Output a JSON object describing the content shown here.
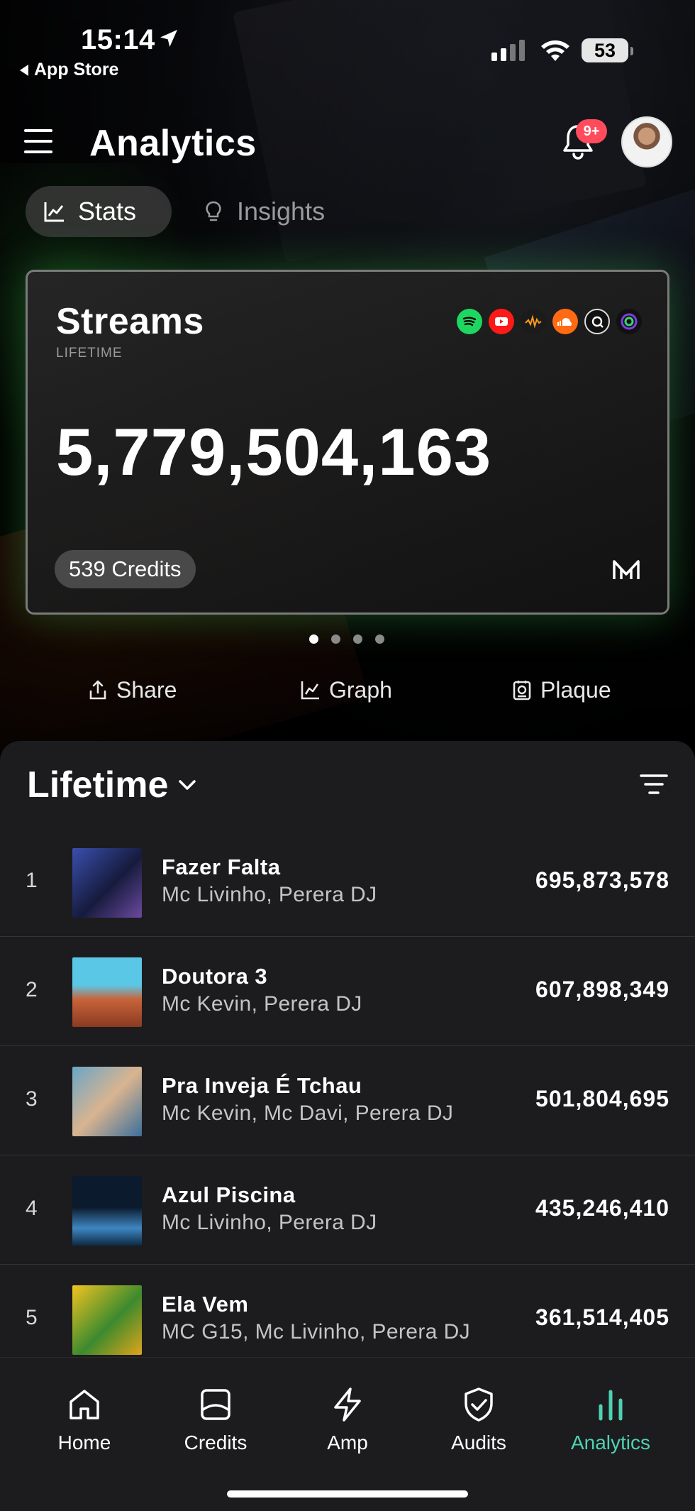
{
  "status_bar": {
    "time": "15:14",
    "back_label": "App Store",
    "battery": "53"
  },
  "header": {
    "title": "Analytics",
    "notification_badge": "9+"
  },
  "tabs": [
    {
      "label": "Stats",
      "icon": "line-chart-icon",
      "selected": true
    },
    {
      "label": "Insights",
      "icon": "lightbulb-icon",
      "selected": false
    }
  ],
  "streams_card": {
    "title": "Streams",
    "subtitle": "LIFETIME",
    "total": "5,779,504,163",
    "credits": "539 Credits",
    "platform_icons": [
      "spotify-icon",
      "youtube-icon",
      "audiomack-icon",
      "soundcloud-icon",
      "tidal-icon",
      "anghami-icon"
    ]
  },
  "carousel": {
    "pages": 4,
    "current": 1
  },
  "actions": {
    "share": "Share",
    "graph": "Graph",
    "plaque": "Plaque"
  },
  "list": {
    "period": "Lifetime",
    "rows": [
      {
        "rank": "1",
        "title": "Fazer Falta",
        "artists": "Mc Livinho, Perera DJ",
        "streams": "695,873,578"
      },
      {
        "rank": "2",
        "title": "Doutora 3",
        "artists": "Mc Kevin, Perera DJ",
        "streams": "607,898,349"
      },
      {
        "rank": "3",
        "title": "Pra Inveja É Tchau",
        "artists": "Mc Kevin, Mc Davi, Perera DJ",
        "streams": "501,804,695"
      },
      {
        "rank": "4",
        "title": "Azul Piscina",
        "artists": "Mc Livinho, Perera DJ",
        "streams": "435,246,410"
      },
      {
        "rank": "5",
        "title": "Ela Vem",
        "artists": "MC G15, Mc Livinho, Perera DJ",
        "streams": "361,514,405"
      }
    ]
  },
  "bottom_nav": [
    {
      "label": "Home",
      "icon": "home-icon",
      "active": false
    },
    {
      "label": "Credits",
      "icon": "credits-icon",
      "active": false
    },
    {
      "label": "Amp",
      "icon": "lightning-icon",
      "active": false
    },
    {
      "label": "Audits",
      "icon": "shield-check-icon",
      "active": false
    },
    {
      "label": "Analytics",
      "icon": "bar-chart-icon",
      "active": true
    }
  ],
  "colors": {
    "accent": "#4fd1b4",
    "badge": "#ff4b5c",
    "sheet": "#1c1c1e",
    "card_glow": "#3cc850"
  }
}
